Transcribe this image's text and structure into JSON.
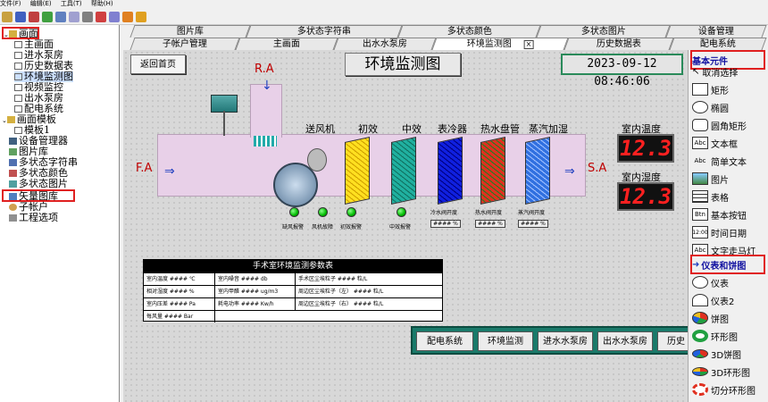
{
  "menu": [
    "文件(F)",
    "编辑(E)",
    "工具(T)",
    "帮助(H)"
  ],
  "tree": {
    "root": "画面",
    "items": [
      "主画面",
      "进水泵房",
      "历史数据表",
      "环境监测图",
      "视频监控",
      "出水泵房",
      "配电系统"
    ],
    "template_group": "画面模板",
    "template_item": "模板1",
    "others": [
      "设备管理器",
      "图片库",
      "多状态字符串",
      "多状态颜色",
      "多状态图片",
      "矢量图库",
      "子帐户",
      "工程选项"
    ]
  },
  "tabs_row1": [
    "图片库",
    "多状态字符串",
    "多状态颜色",
    "多状态图片",
    "设备管理"
  ],
  "tabs_row2": [
    "子帐户管理",
    "主画面",
    "出水水泵房",
    "环境监测图",
    "历史数据表",
    "配电系统"
  ],
  "tab_close": "×",
  "canvas": {
    "back_button": "返回首页",
    "title": "环境监测图",
    "datetime": "2023-09-12 08:46:06",
    "ra": "R.A",
    "fa": "F.A",
    "sa": "S.A",
    "sections": [
      "送风机",
      "初效",
      "中效",
      "表冷器",
      "热水盘管",
      "蒸汽加湿"
    ],
    "temp_label": "室内温度",
    "temp_value": "12.3",
    "hum_label": "室内湿度",
    "hum_value": "12.3",
    "alarms": [
      "缺风报警",
      "风机故障",
      "初效报警",
      "中效报警"
    ],
    "valve_labels": [
      "冷水阀开度",
      "热水阀开度",
      "蒸汽阀开度"
    ],
    "valve_values": [
      "#### %",
      "#### %",
      "#### %"
    ],
    "table": {
      "title": "手术室环境监测参数表",
      "rows": [
        [
          "室内温度 #### ℃",
          "室内噪音 #### db",
          "手术区尘埃粒子 #### 粒/L"
        ],
        [
          "相对湿度 #### %",
          "室内甲醛 #### ug/m3",
          "周边区尘埃粒子（左） #### 粒/L"
        ],
        [
          "室内压差 #### Pa",
          "耗电功率 #### Kw/h",
          "周边区尘埃粒子（右） #### 粒/L"
        ],
        [
          "每风量 #### Bar",
          "",
          ""
        ]
      ]
    },
    "nav": [
      "配电系统",
      "环境监测",
      "进水水泵房",
      "出水水泵房",
      "历史"
    ]
  },
  "palette": {
    "basic_header": "基本元件",
    "basic": [
      "取消选择",
      "矩形",
      "椭圆",
      "圆角矩形",
      "文本框",
      "简单文本",
      "图片",
      "表格",
      "基本按钮",
      "时间日期",
      "文字走马灯"
    ],
    "icons": [
      "Abc",
      "Abc",
      "Btn",
      "12:00",
      "Abc"
    ],
    "chart_header": "仪表和饼图",
    "charts": [
      "仪表",
      "仪表2",
      "饼图",
      "环形图",
      "3D饼图",
      "3D环形图",
      "切分环形图"
    ]
  },
  "colors": {
    "accent": "#e02020",
    "nav": "#1a7a6a",
    "filter1": "#ffe020",
    "filter2": "#20b0a0",
    "coil1": "#1020e0",
    "coil2": "#e03020",
    "coil3": "#3070e0"
  }
}
